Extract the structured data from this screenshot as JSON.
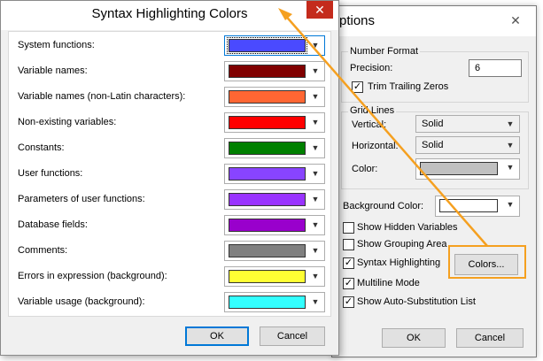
{
  "options_window": {
    "title_partial": "ptions",
    "close_glyph": "✕",
    "number_format": {
      "group_label": "Number Format",
      "precision_label": "Precision:",
      "precision_value": "6",
      "trim_trailing_zeros_label": "Trim Trailing Zeros",
      "trim_trailing_zeros_checked": true
    },
    "grid_lines": {
      "group_label": "Grid Lines",
      "vertical_label": "Vertical:",
      "vertical_value": "Solid",
      "horizontal_label": "Horizontal:",
      "horizontal_value": "Solid",
      "color_label": "Color:",
      "color_value": "#c0c0c0"
    },
    "background_color_label": "Background Color:",
    "background_color_value": "#ffffff",
    "checkboxes": [
      {
        "label": "Show Hidden Variables",
        "checked": false
      },
      {
        "label": "Show Grouping Area",
        "checked": false
      },
      {
        "label": "Syntax Highlighting",
        "checked": true
      },
      {
        "label": "Multiline Mode",
        "checked": true
      },
      {
        "label": "Show Auto-Substitution List",
        "checked": true
      }
    ],
    "colors_button_label": "Colors...",
    "ok_label": "OK",
    "cancel_label": "Cancel"
  },
  "syntax_dialog": {
    "title": "Syntax Highlighting Colors",
    "close_glyph": "✕",
    "rows": [
      {
        "label": "System functions:",
        "color": "#4a4aff"
      },
      {
        "label": "Variable names:",
        "color": "#800000"
      },
      {
        "label": "Variable names (non-Latin characters):",
        "color": "#ff6633"
      },
      {
        "label": "Non-existing variables:",
        "color": "#ff0000"
      },
      {
        "label": "Constants:",
        "color": "#008000"
      },
      {
        "label": "User functions:",
        "color": "#8844ff"
      },
      {
        "label": "Parameters of user functions:",
        "color": "#9933ff"
      },
      {
        "label": "Database fields:",
        "color": "#9900cc"
      },
      {
        "label": "Comments:",
        "color": "#808080"
      },
      {
        "label": "Errors in expression (background):",
        "color": "#ffff33"
      },
      {
        "label": "Variable usage (background):",
        "color": "#33ffff"
      }
    ],
    "ok_label": "OK",
    "cancel_label": "Cancel"
  },
  "annotation": {
    "highlight_color": "#f5a020"
  }
}
